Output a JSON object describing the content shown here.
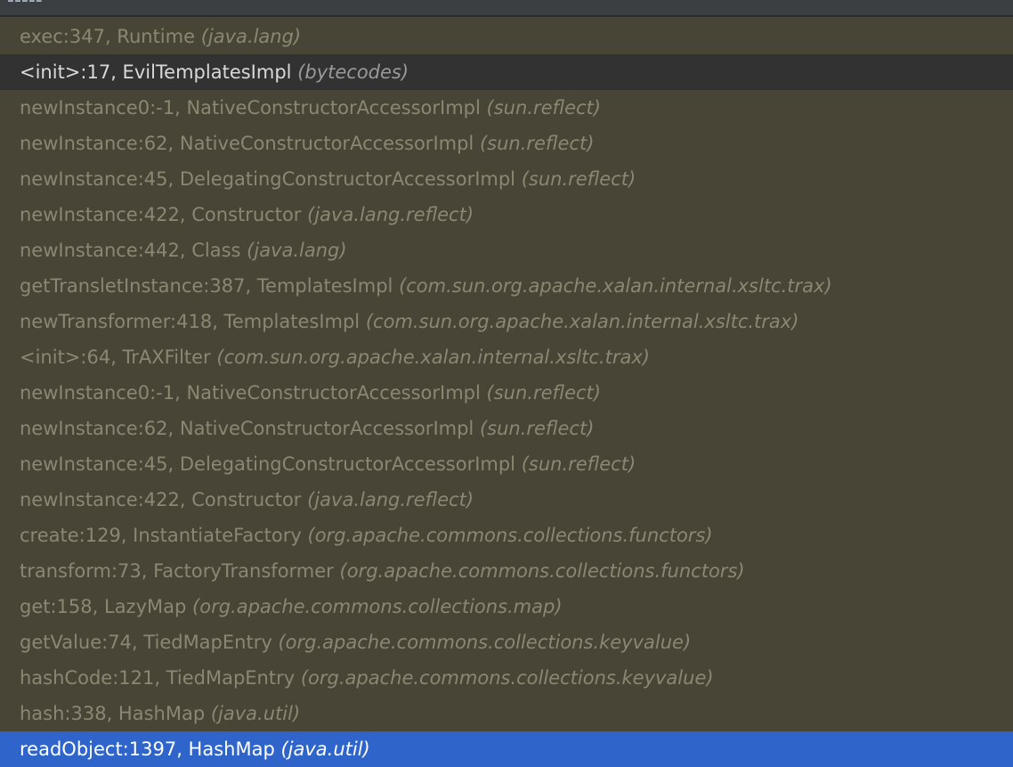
{
  "header": {
    "clipped_text": "-----",
    "colors": {
      "background": "#3c3f41",
      "border": "#2b2b2b"
    }
  },
  "frames": [
    {
      "method": "exec:347, Runtime",
      "package": "(java.lang)"
    },
    {
      "method": "<init>:17, EvilTemplatesImpl",
      "package": "(bytecodes)",
      "state": "current"
    },
    {
      "method": "newInstance0:-1, NativeConstructorAccessorImpl",
      "package": "(sun.reflect)"
    },
    {
      "method": "newInstance:62, NativeConstructorAccessorImpl",
      "package": "(sun.reflect)"
    },
    {
      "method": "newInstance:45, DelegatingConstructorAccessorImpl",
      "package": "(sun.reflect)"
    },
    {
      "method": "newInstance:422, Constructor",
      "package": "(java.lang.reflect)"
    },
    {
      "method": "newInstance:442, Class",
      "package": "(java.lang)"
    },
    {
      "method": "getTransletInstance:387, TemplatesImpl",
      "package": "(com.sun.org.apache.xalan.internal.xsltc.trax)"
    },
    {
      "method": "newTransformer:418, TemplatesImpl",
      "package": "(com.sun.org.apache.xalan.internal.xsltc.trax)"
    },
    {
      "method": "<init>:64, TrAXFilter",
      "package": "(com.sun.org.apache.xalan.internal.xsltc.trax)"
    },
    {
      "method": "newInstance0:-1, NativeConstructorAccessorImpl",
      "package": "(sun.reflect)"
    },
    {
      "method": "newInstance:62, NativeConstructorAccessorImpl",
      "package": "(sun.reflect)"
    },
    {
      "method": "newInstance:45, DelegatingConstructorAccessorImpl",
      "package": "(sun.reflect)"
    },
    {
      "method": "newInstance:422, Constructor",
      "package": "(java.lang.reflect)"
    },
    {
      "method": "create:129, InstantiateFactory",
      "package": "(org.apache.commons.collections.functors)"
    },
    {
      "method": "transform:73, FactoryTransformer",
      "package": "(org.apache.commons.collections.functors)"
    },
    {
      "method": "get:158, LazyMap",
      "package": "(org.apache.commons.collections.map)"
    },
    {
      "method": "getValue:74, TiedMapEntry",
      "package": "(org.apache.commons.collections.keyvalue)"
    },
    {
      "method": "hashCode:121, TiedMapEntry",
      "package": "(org.apache.commons.collections.keyvalue)"
    },
    {
      "method": "hash:338, HashMap",
      "package": "(java.util)"
    },
    {
      "method": "readObject:1397, HashMap",
      "package": "(java.util)",
      "state": "selected"
    }
  ],
  "colors": {
    "list_background": "#484537",
    "library_frame_text": "#8b8772",
    "current_frame_background": "#323232",
    "current_frame_text": "#d9d9d9",
    "selected_frame_background": "#2f65ca",
    "selected_frame_text": "#ffffff"
  }
}
